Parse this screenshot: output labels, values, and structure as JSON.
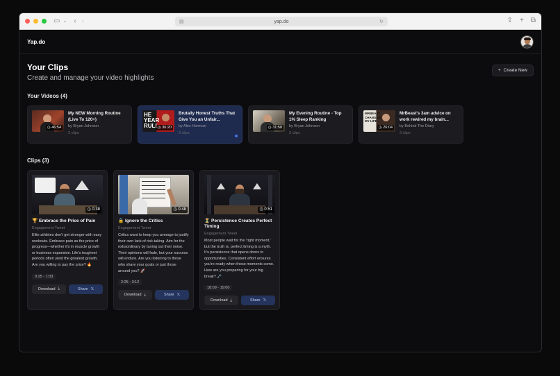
{
  "browser": {
    "url": "yap.do",
    "traffic_lights": [
      "#fe5f57",
      "#febc2e",
      "#28c840"
    ]
  },
  "app": {
    "logo": "Yap.do",
    "avatar_icon": "user-avatar"
  },
  "header": {
    "title": "Your Clips",
    "subtitle": "Create and manage your video highlights",
    "new_button": "Create New"
  },
  "videos_section": {
    "title": "Your Videos (4)",
    "items": [
      {
        "title": "My NEW Morning Routine (Live To 120+)",
        "author": "by Bryan Johnson",
        "clips": "2 clips",
        "duration": "46:54",
        "thumb_color": "#7a2a1c",
        "active": false
      },
      {
        "title": "Brutally Honest Truths That Give You an Unfair...",
        "author": "by Alex Hormozi",
        "clips": "3 clips",
        "duration": "36:20",
        "thumb_color": "#b12020",
        "thumb_label": "HE YEAR RULL",
        "active": true
      },
      {
        "title": "My Evening Routine - Top 1% Sleep Ranking",
        "author": "by Bryan Johnson",
        "clips": "2 clips",
        "duration": "31:58",
        "thumb_color": "#8a8a7a",
        "active": false
      },
      {
        "title": "MrBeast's 3am advice on work rewired my brain...",
        "author": "by Behind The Diary",
        "clips": "3 clips",
        "duration": "26:04",
        "thumb_color": "#3a2a22",
        "thumb_label": "MRBEAST CHANGED MY LIFE",
        "active": false
      }
    ]
  },
  "clips_section": {
    "title": "Clips (3)",
    "items": [
      {
        "title": "🏆 Embrace the Price of Pain",
        "tag": "Engagement Tweet",
        "text": "Elite athletes don't get stronger with easy workouts. Embrace pain as the price of progress—whether it's in muscle growth or business expansion. Life's toughest periods often yield the greatest growth. Are you willing to pay the price? 🔥",
        "time": "0:25 - 1:03",
        "duration": "0:38",
        "download": "Download",
        "share": "Share"
      },
      {
        "title": "🔒 Ignore the Critics",
        "tag": "Engagement Tweet",
        "text": "Critics want to keep you average to justify their own lack of risk-taking. Aim for the extraordinary by tuning out their noise. Their opinions will fade, but your success will endure. Are you listening to those who share your goals or just those around you? 🚀",
        "time": "2:25 - 3:12",
        "duration": "0:48",
        "download": "Download",
        "share": "Share"
      },
      {
        "title": "⏳ Persistence Creates Perfect Timing",
        "tag": "Engagement Tweet",
        "text": "Most people wait for the 'right moment,' but the truth is, perfect timing is a myth. It's persistence that opens doors to opportunities. Consistent effort ensures you're ready when those moments come. How are you preparing for your big break? 🗝️",
        "time": "18:09 - 19:00",
        "duration": "0:51",
        "download": "Download",
        "share": "Share"
      }
    ]
  }
}
